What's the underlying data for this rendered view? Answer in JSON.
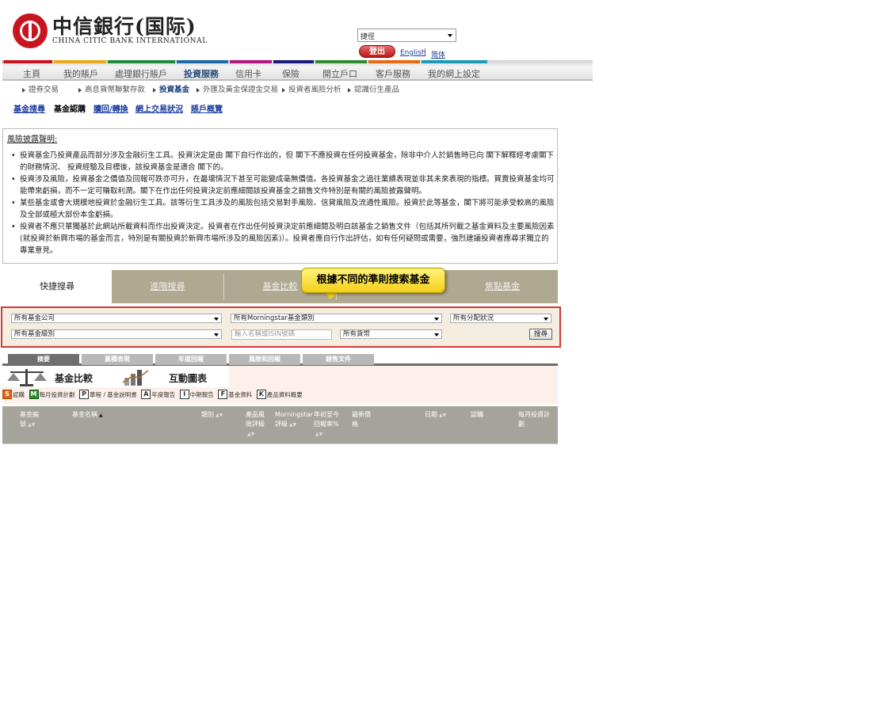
{
  "header": {
    "logo_cn": "中信銀行(国际)",
    "logo_en": "CHINA CITIC BANK INTERNATIONAL",
    "lang_select_value": "捷徑",
    "logout_label": "登出",
    "english_label": "English",
    "lang_separator": "|",
    "simplified_label": "简体"
  },
  "nav": {
    "items": [
      {
        "label": "主頁"
      },
      {
        "label": "我的賬戶"
      },
      {
        "label": "處理銀行賬戶"
      },
      {
        "label": "投資服務"
      },
      {
        "label": "信用卡"
      },
      {
        "label": "保險"
      },
      {
        "label": "開立戶口"
      },
      {
        "label": "客戶服務"
      },
      {
        "label": "我的網上設定"
      }
    ],
    "stripe_colors": [
      "#c8141e",
      "#e8a91a",
      "#1e8a3a",
      "#1e6aa8",
      "#b0147e",
      "#1a1a7c",
      "#2e8a2e",
      "#e86a14",
      "#1e9ab8"
    ]
  },
  "subnav": {
    "items": [
      {
        "label": "證券交易"
      },
      {
        "label": "高息貨幣聯繫存款"
      },
      {
        "label": "投資基金"
      },
      {
        "label": "外匯及黃金保證金交易"
      },
      {
        "label": "投資者風險分析"
      },
      {
        "label": "認識衍生產品"
      }
    ]
  },
  "fund_nav": {
    "items": [
      {
        "label": "基金搜尋"
      },
      {
        "label": "基金認購"
      },
      {
        "label": "贖回/轉換"
      },
      {
        "label": "網上交易狀況"
      },
      {
        "label": "賬戶概覽"
      }
    ]
  },
  "risk": {
    "title": "風險披露聲明:",
    "items": [
      "投資基金乃投資產品而部分涉及金融衍生工具。投資決定是由 閣下自行作出的，但 閣下不應投資在任何投資基金，除非中介人於銷售時已向 閣下解釋經考慮閣下的財務情況、 投資經驗及目標後，該投資基金是適合 閣下的。",
      "投資涉及風險，投資基金之價值及回報可跌亦可升，在最壞情況下甚至可能變成毫無價值。各投資基金之過往業績表現並非其未來表現的指標。買賣投資基金均可能帶來虧損，而不一定可賺取利潤。閣下在作出任何投資決定前應細閱該投資基金之銷售文件特別是有關的風險披露聲明。",
      "某些基金或會大規模地投資於金融衍生工具。該等衍生工具涉及的風險包括交易對手風險、信貸風險及流通性風險。投資於此等基金，閣下將可能承受較高的風險及全部或極大部份本金虧損。",
      "投資者不應只單獨基於此網站所載資料而作出投資決定。投資者在作出任何投資決定前應細閱及明白該基金之銷售文件（包括其所列載之基金資料及主要風險因素(就投資於新興市場的基金而言，特別是有關投資於新興市場所涉及的風險因素)）。投資者應自行作出評估，如有任何疑問或需要，強烈建議投資者應尋求獨立的專業意見。"
    ]
  },
  "search_tabs": {
    "items": [
      {
        "label": "快捷搜尋"
      },
      {
        "label": "進階搜尋"
      },
      {
        "label": "基金比較"
      },
      {
        "label": "焦點基金"
      }
    ],
    "callout": "根據不同的準則搜索基金"
  },
  "filters": {
    "fund_company": "所有基金公司",
    "morningstar_category": "所有Morningstar基金類別",
    "distribution": "所有分配狀況",
    "fund_class": "所有基金級別",
    "search_placeholder": "輸入名稱或ISIN號碼",
    "currency": "所有貨幣",
    "search_button": "搜尋"
  },
  "result_tabs": {
    "items": [
      {
        "label": "摘要"
      },
      {
        "label": "累積表現"
      },
      {
        "label": "年度回報"
      },
      {
        "label": "風險和回報"
      },
      {
        "label": "銷售文件"
      }
    ]
  },
  "tools": {
    "compare_label": "基金比較",
    "chart_label": "互動圖表"
  },
  "legend": {
    "items": [
      {
        "code": "S",
        "label": "認購",
        "color": "#e06414"
      },
      {
        "code": "M",
        "label": "每月投資計劃",
        "color": "#2e8a2e"
      },
      {
        "code": "P",
        "label": "章程 / 基金說明書",
        "color": "#ffffff"
      },
      {
        "code": "A",
        "label": "年度報告",
        "color": "#ffffff"
      },
      {
        "code": "I",
        "label": "中期報告",
        "color": "#ffffff"
      },
      {
        "code": "F",
        "label": "基金資料",
        "color": "#ffffff"
      },
      {
        "code": "K",
        "label": "產品資料概要",
        "color": "#ffffff"
      }
    ]
  },
  "table": {
    "columns": [
      {
        "label": "基金編號"
      },
      {
        "label": "基金名稱"
      },
      {
        "label": "類別"
      },
      {
        "label": "產品風險評級"
      },
      {
        "label": "Morningstar評級"
      },
      {
        "label": "年初至今回報率%"
      },
      {
        "label": "最新價格"
      },
      {
        "label": "日期"
      },
      {
        "label": "認購"
      },
      {
        "label": "每月投資計劃"
      }
    ]
  }
}
